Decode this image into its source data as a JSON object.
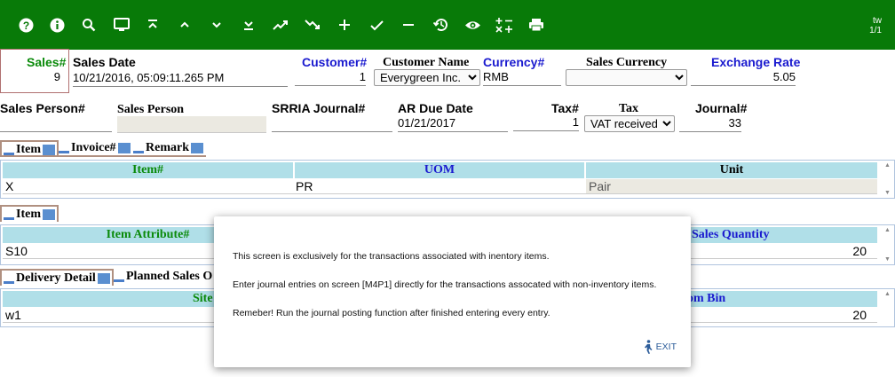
{
  "toolbar": {
    "icons": [
      "help-icon",
      "info-icon",
      "search-icon",
      "monitor-icon",
      "first-record-icon",
      "previous-record-icon",
      "next-record-icon",
      "last-record-icon",
      "trend-up-icon",
      "trend-down-icon",
      "add-icon",
      "confirm-icon",
      "delete-icon",
      "history-icon",
      "view-icon",
      "calculator-icon",
      "print-icon"
    ],
    "badge_top": "tw",
    "badge_bottom": "1/1",
    "color": "#087a08"
  },
  "header": {
    "sales_label": "Sales#",
    "sales_value": "9",
    "sales_date_label": "Sales Date",
    "sales_date_value": "10/21/2016, 05:09:11.265 PM",
    "customer_label": "Customer#",
    "customer_value": "1",
    "customer_name_label": "Customer Name",
    "customer_name_value": "Everygreen Inc.",
    "currency_label": "Currency#",
    "currency_value": "RMB",
    "sales_currency_label": "Sales Currency",
    "sales_currency_value": "",
    "exchange_rate_label": "Exchange Rate",
    "exchange_rate_value": "5.05",
    "sales_person_no_label": "Sales Person#",
    "sales_person_no_value": "",
    "sales_person_label": "Sales Person",
    "sales_person_value": "",
    "srria_label": "SRRIA Journal#",
    "srria_value": "",
    "ar_due_label": "AR Due Date",
    "ar_due_value": "01/21/2017",
    "tax_no_label": "Tax#",
    "tax_no_value": "1",
    "tax_label": "Tax",
    "tax_value": "VAT received",
    "journal_label": "Journal#",
    "journal_value": "33"
  },
  "tabs1": [
    "Item",
    "Invoice#",
    "Remark"
  ],
  "grid1": {
    "headers": [
      "Item#",
      "UOM",
      "Unit"
    ],
    "row": [
      "X",
      "PR",
      "Pair"
    ]
  },
  "tabs2": [
    "Item"
  ],
  "grid2": {
    "headers": [
      "Item Attribute#",
      "Sales Quantity"
    ],
    "row": [
      "S10",
      "20"
    ]
  },
  "tabs3": [
    "Delivery Detail",
    "Planned Sales O"
  ],
  "grid3": {
    "headers": [
      "Site",
      "om Bin"
    ],
    "row": [
      "w1",
      "20"
    ]
  },
  "dialog": {
    "line1": "This screen is exclusively for the transactions associated with inentory items.",
    "line2": "Enter journal entries on screen [M4P1] directly for the transactions assocated with non-inventory items.",
    "line3": "Remeber! Run the journal posting function after finished entering every entry.",
    "exit_label": "EXIT"
  }
}
